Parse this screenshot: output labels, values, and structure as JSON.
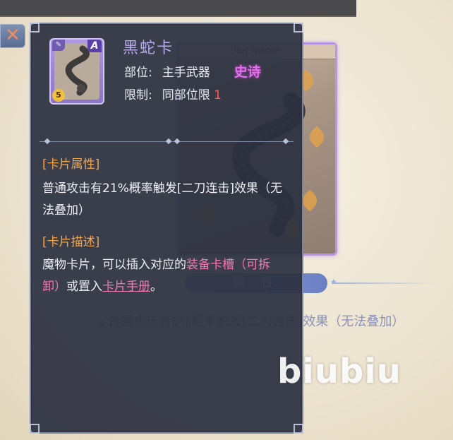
{
  "background": {
    "attr_tab_label": "属 性",
    "effect_text": "普通攻击有6%概率触发[二刀连击]效果（无法叠加）",
    "card_banner": "NOT WINDER",
    "watermark": "biubiu"
  },
  "close_button": "✕",
  "tooltip": {
    "card_name": "黑蛇卡",
    "rank_badge": "A",
    "level_badge": "5",
    "slot_label": "部位:",
    "slot_value": "主手武器",
    "rarity": "史诗",
    "limit_label": "限制:",
    "limit_value": "同部位限",
    "limit_count": "1",
    "attr_title": "[卡片属性]",
    "attr_text": "普通攻击有21%概率触发[二刀连击]效果（无法叠加）",
    "desc_title": "[卡片描述]",
    "desc_part1": "魔物卡片，可以插入对应的",
    "desc_link1": "装备卡槽（可拆卸）",
    "desc_part2": "或置入",
    "desc_link2": "卡片手册",
    "desc_end": "。"
  },
  "colors": {
    "rarity_epic": "#e070e8",
    "section_title": "#f4a64a",
    "link_pink": "#f07ab0",
    "limit_red": "#ff5a5a",
    "card_name": "#b7a8f0"
  }
}
